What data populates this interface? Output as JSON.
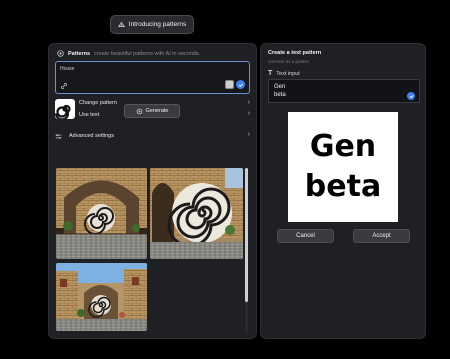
{
  "top_pill": {
    "label": "Introducing patterns",
    "icon": "pattern-icon"
  },
  "left_panel": {
    "header_title": "Patterns",
    "header_subtitle": "create beautiful patterns with AI in seconds.",
    "prompt": {
      "value": "House"
    },
    "change_pattern_label": "Change pattern",
    "use_text_label": "Use text",
    "advanced_settings_label": "Advanced settings",
    "generate_label": "Generate"
  },
  "right_panel": {
    "title": "Create a text pattern",
    "subtitle": "Use text as a pattern",
    "input_label": "Text input",
    "input_line1": "Gen",
    "input_line2": "beta",
    "preview_line1": "Gen",
    "preview_line2": "beta",
    "cancel_label": "Cancel",
    "accept_label": "Accept"
  },
  "colors": {
    "accent": "#3b82f6",
    "panel": "#1f2024",
    "background": "#000000"
  }
}
